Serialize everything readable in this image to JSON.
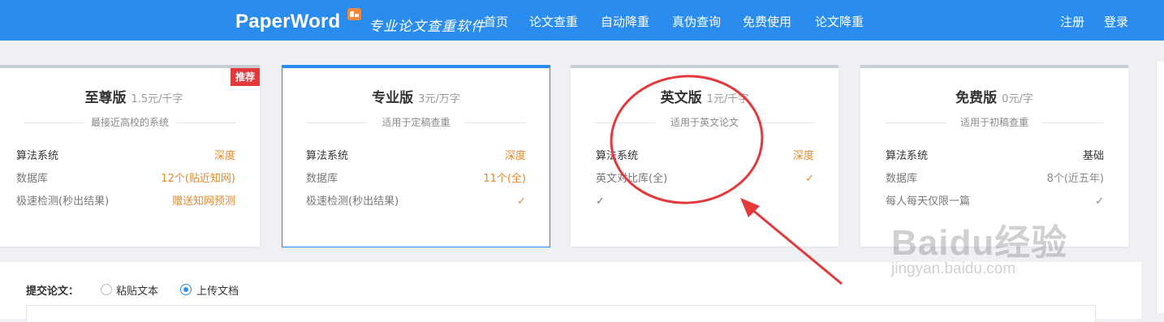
{
  "header": {
    "logo": "PaperWord",
    "slogan": "专业论文查重软件",
    "nav": [
      "首页",
      "论文查重",
      "自动降重",
      "真伪查询",
      "免费使用",
      "论文降重"
    ],
    "auth": {
      "register": "注册",
      "login": "登录"
    }
  },
  "plans": [
    {
      "name": "至尊版",
      "price": "1.5元/千字",
      "subtitle": "最接近高校的系统",
      "ribbon": "推荐",
      "rows": [
        {
          "label": "算法系统",
          "value": "深度"
        },
        {
          "label": "数据库",
          "value": "12个(贴近知网)"
        },
        {
          "label": "极速检测(秒出结果)",
          "value": "赠送知网预测"
        }
      ]
    },
    {
      "name": "专业版",
      "price": "3元/万字",
      "subtitle": "适用于定稿查重",
      "rows": [
        {
          "label": "算法系统",
          "value": "深度"
        },
        {
          "label": "数据库",
          "value": "11个(全)"
        },
        {
          "label": "极速检测(秒出结果)",
          "value": "✓"
        }
      ]
    },
    {
      "name": "英文版",
      "price": "1元/千字",
      "subtitle": "适用于英文论文",
      "rows": [
        {
          "label": "算法系统",
          "value": "深度"
        },
        {
          "label": "英文对比库(全)",
          "value": "✓"
        },
        {
          "label": "✓",
          "value": ""
        }
      ]
    },
    {
      "name": "免费版",
      "price": "0元/字",
      "subtitle": "适用于初稿查重",
      "rows": [
        {
          "label": "算法系统",
          "value": "基础"
        },
        {
          "label": "数据库",
          "value": "8个(近五年)"
        },
        {
          "label": "每人每天仅限一篇",
          "value": "✓"
        }
      ]
    }
  ],
  "submit": {
    "label": "提交论文：",
    "options": [
      "粘贴文本",
      "上传文档"
    ],
    "selected": "上传文档"
  },
  "watermark": {
    "brand": "Baidu经验",
    "sub": "jingyan.baidu.com"
  },
  "colors": {
    "header_bg": "#2b8cef",
    "accent_orange": "#e08a2e",
    "ribbon_red": "#e4393c",
    "annotation_red": "#e5383b"
  }
}
